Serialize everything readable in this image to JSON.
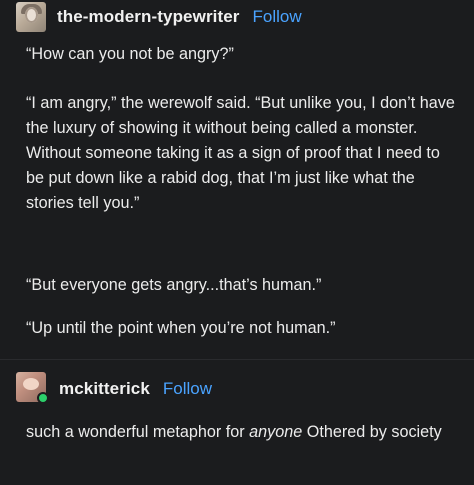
{
  "posts": [
    {
      "user": "the-modern-typewriter",
      "follow_label": "Follow",
      "avatar_icon": "avatar-portrait",
      "paragraphs": [
        "“How can you not be angry?”",
        "“I am angry,” the werewolf said. “But unlike you, I don’t have the luxury of showing it without being called a monster. Without someone taking it as a sign of proof that I need to be put down like a rabid dog, that I’m just like what the stories tell you.”",
        "“But everyone gets angry...that’s human.”",
        "“Up until the point when you’re not human.”"
      ]
    },
    {
      "user": "mckitterick",
      "follow_label": "Follow",
      "avatar_icon": "avatar-portrait",
      "status_color": "#2ccf6a",
      "reply_before": "such a wonderful metaphor for ",
      "reply_em": "anyone",
      "reply_after": " Othered by society"
    }
  ],
  "colors": {
    "background": "#1b1c1e",
    "text": "#ececec",
    "link": "#4aa3ff"
  }
}
